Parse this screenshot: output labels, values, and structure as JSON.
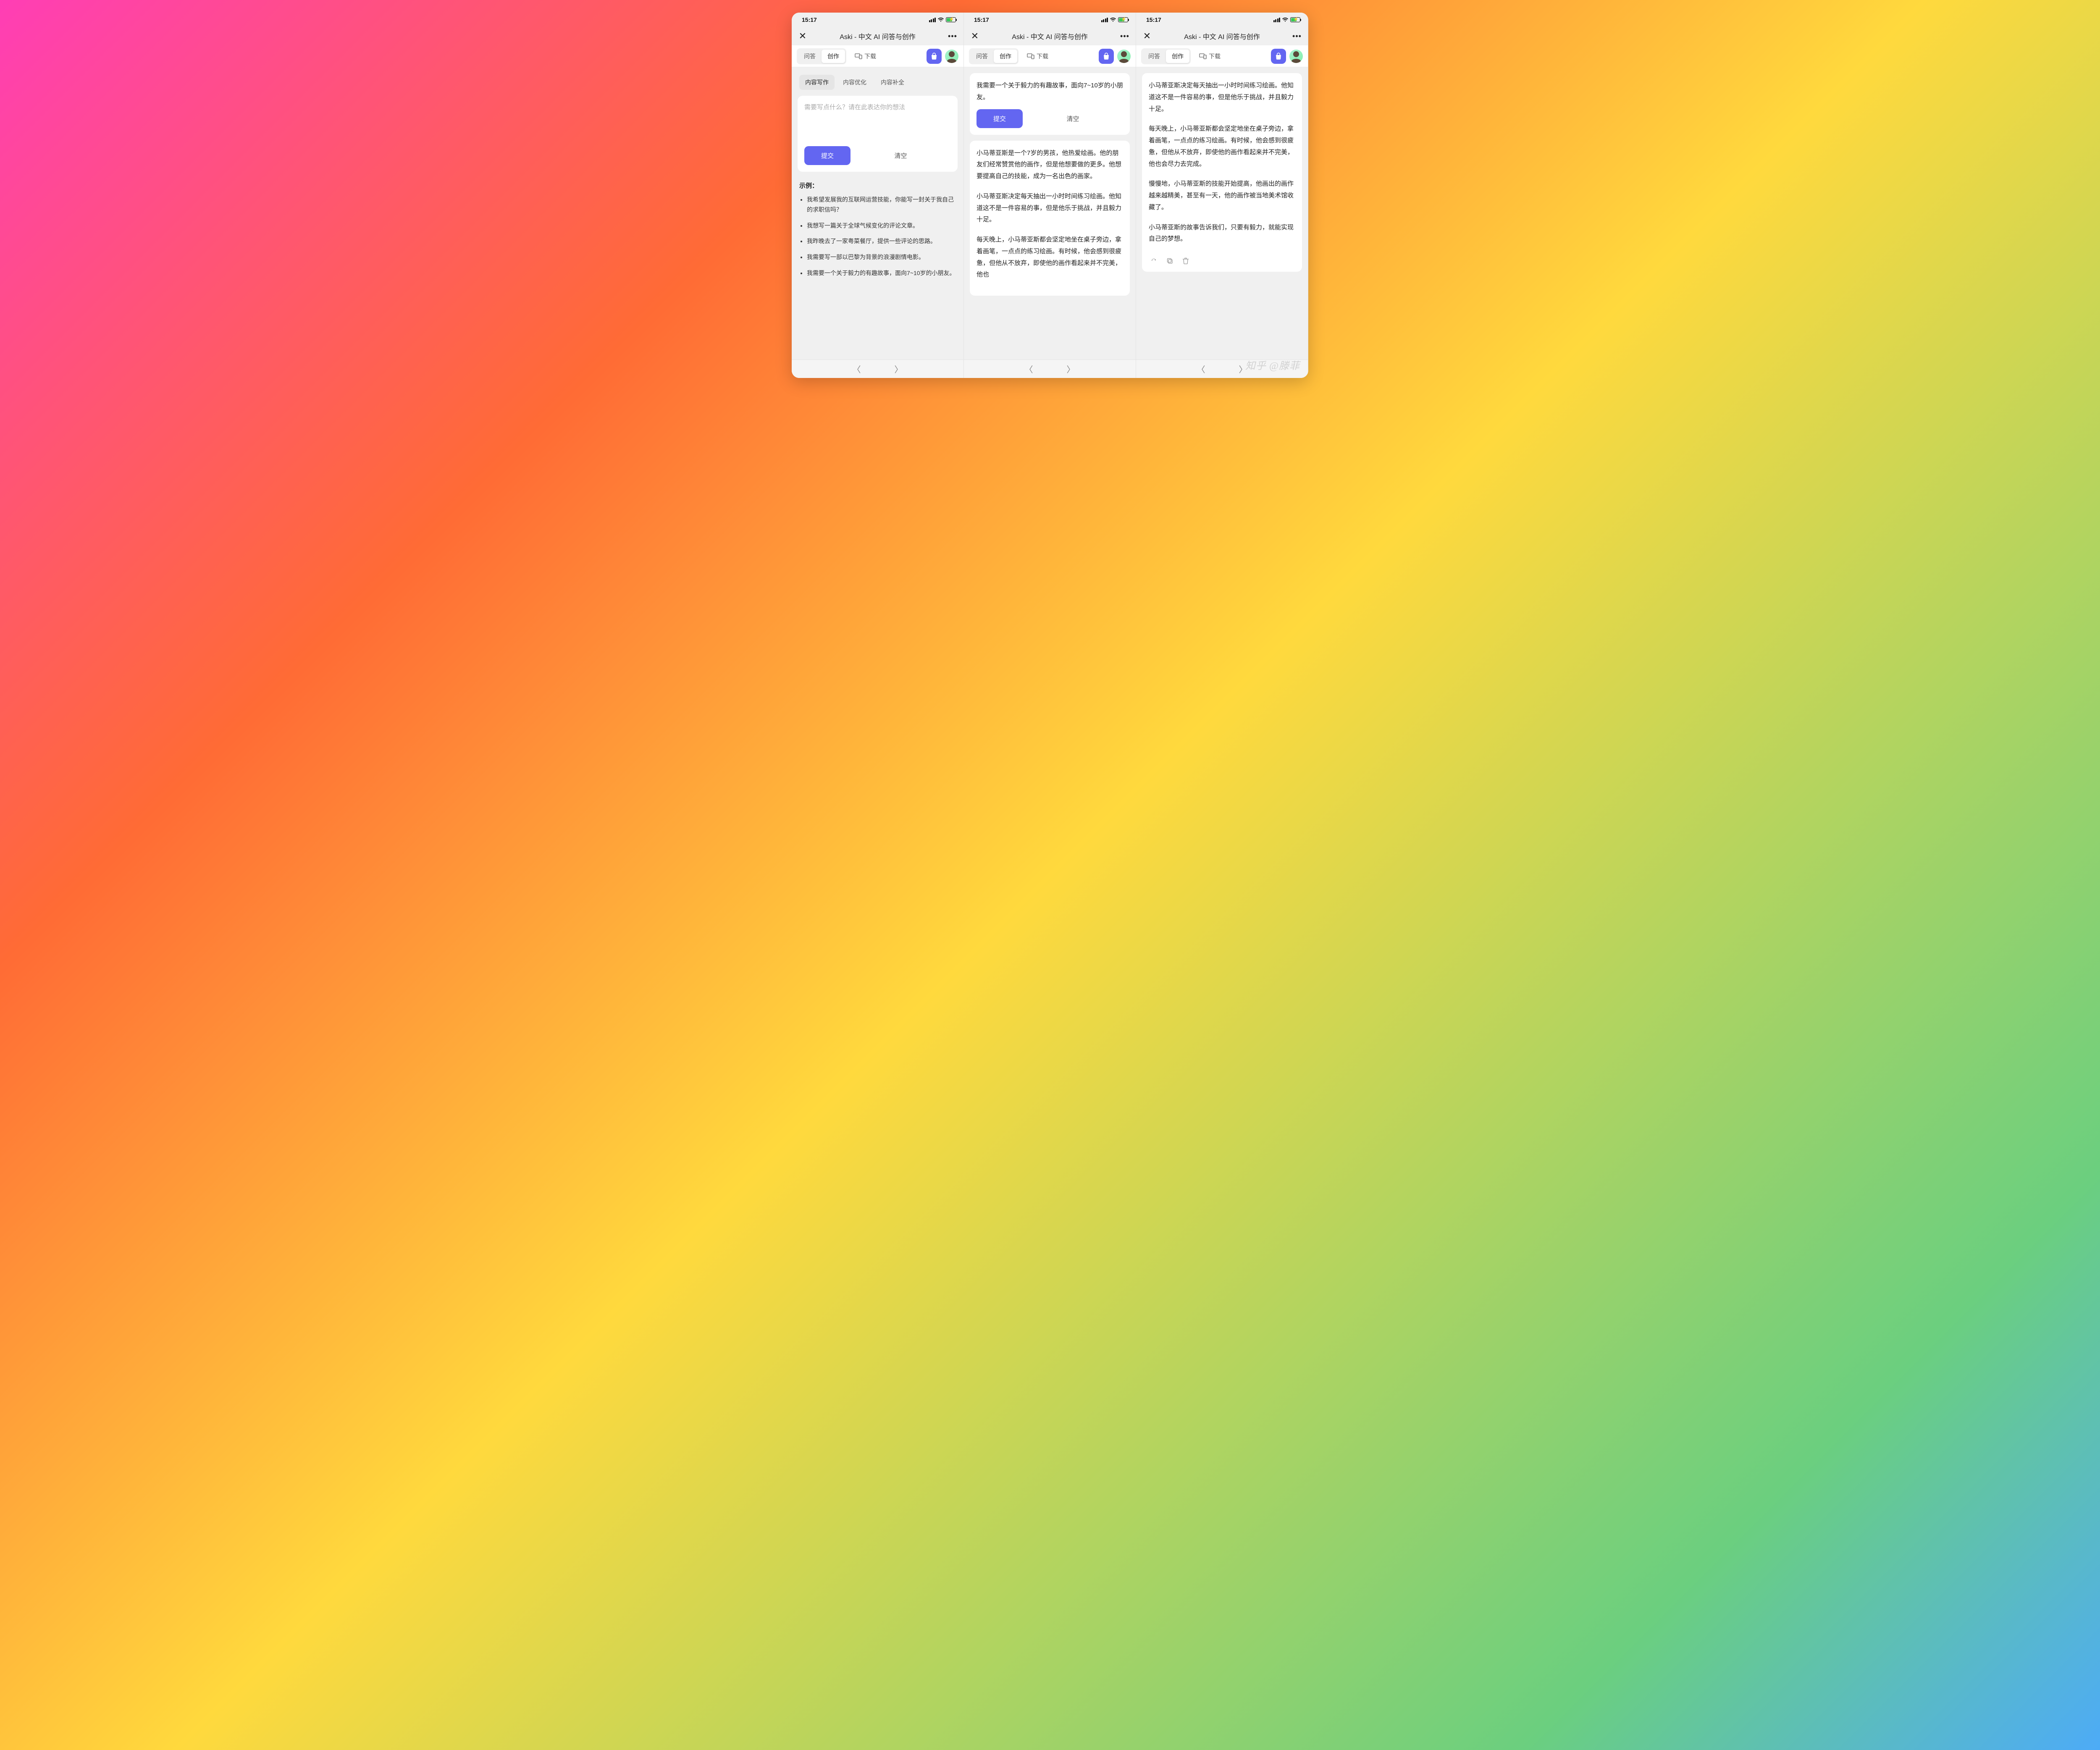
{
  "status": {
    "time": "15:17"
  },
  "titlebar": {
    "title": "Aski - 中文 AI 问答与创作"
  },
  "toolbar": {
    "seg": {
      "qa": "问答",
      "create": "创作"
    },
    "download": "下载"
  },
  "pane1": {
    "subtabs": {
      "write": "内容写作",
      "optimize": "内容优化",
      "complete": "内容补全"
    },
    "placeholder": "需要写点什么？请在此表达你的想法",
    "submit": "提交",
    "clear": "清空",
    "examples_title": "示例：",
    "examples": [
      "我希望发展我的互联网运营技能，你能写一封关于我自己的求职信吗？",
      "我想写一篇关于全球气候变化的评论文章。",
      "我昨晚去了一家粤菜餐厅，提供一些评论的思路。",
      "我需要写一部以巴黎为背景的浪漫剧情电影。",
      "我需要一个关于毅力的有趣故事，面向7~10岁的小朋友。"
    ]
  },
  "pane2": {
    "prompt": "我需要一个关于毅力的有趣故事，面向7~10岁的小朋友。",
    "submit": "提交",
    "clear": "清空",
    "story": [
      "小马蒂亚斯是一个7岁的男孩，他热爱绘画。他的朋友们经常赞赏他的画作，但是他想要做的更多。他想要提高自己的技能，成为一名出色的画家。",
      "小马蒂亚斯决定每天抽出一小时时间练习绘画。他知道这不是一件容易的事，但是他乐于挑战，并且毅力十足。",
      "每天晚上，小马蒂亚斯都会坚定地坐在桌子旁边，拿着画笔，一点点的练习绘画。有时候，他会感到很疲惫，但他从不放弃，即使他的画作看起来并不完美，他也"
    ]
  },
  "pane3": {
    "story": [
      "小马蒂亚斯决定每天抽出一小时时间练习绘画。他知道这不是一件容易的事，但是他乐于挑战，并且毅力十足。",
      "每天晚上，小马蒂亚斯都会坚定地坐在桌子旁边，拿着画笔，一点点的练习绘画。有时候，他会感到很疲惫，但他从不放弃，即使他的画作看起来并不完美，他也会尽力去完成。",
      "慢慢地，小马蒂亚斯的技能开始提高，他画出的画作越来越精美，甚至有一天，他的画作被当地美术馆收藏了。",
      "小马蒂亚斯的故事告诉我们，只要有毅力，就能实现自己的梦想。"
    ]
  },
  "watermark": "知乎 @滕菲"
}
